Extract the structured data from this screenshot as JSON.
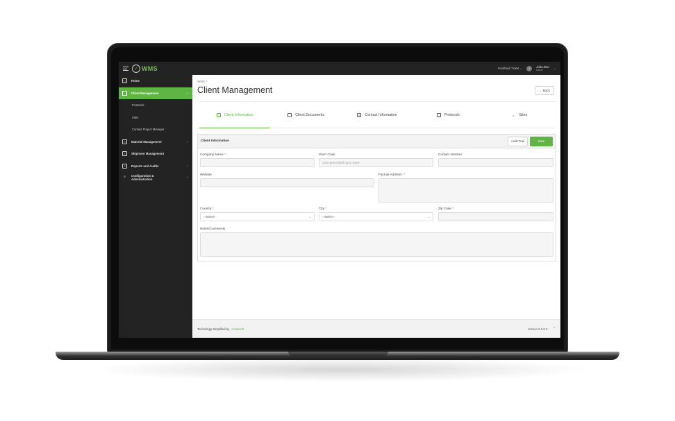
{
  "topbar": {
    "logo_text": "WMS",
    "logo_sub": "",
    "feedback": "Feedback Ticket",
    "user_name": "John.Doe",
    "user_role": "Admin",
    "avatar_initials": "J"
  },
  "sidebar": {
    "items": [
      {
        "label": "Home"
      },
      {
        "label": "Client Management"
      },
      {
        "label": "Protocols"
      },
      {
        "label": "Sites"
      },
      {
        "label": "Contact Project Manager"
      },
      {
        "label": "Material Management"
      },
      {
        "label": "Shipment Management"
      },
      {
        "label": "Reports and Audits"
      },
      {
        "label": "Configuration &"
      },
      {
        "label": "Administration"
      }
    ]
  },
  "main": {
    "breadcrumb": "WMS  \\",
    "title": "Client Management",
    "back_label": "← Back",
    "tabs": [
      {
        "label": "Client Information"
      },
      {
        "label": "Client Documents"
      },
      {
        "label": "Contact Information"
      },
      {
        "label": "Protocols"
      },
      {
        "label": "Sites"
      }
    ],
    "panel": {
      "title": "Client Information",
      "audit_label": "Audit Trail",
      "save_label": "Save",
      "fields": {
        "company_name": {
          "label": "Company Name",
          "value": ""
        },
        "short_code": {
          "label": "Short Code",
          "placeholder": "Auto-generated upon Save"
        },
        "contact_number": {
          "label": "Contact Number",
          "value": ""
        },
        "website": {
          "label": "Website",
          "value": ""
        },
        "factual_address": {
          "label": "Factual Address:",
          "value": ""
        },
        "country": {
          "label": "Country",
          "value": "--Select--"
        },
        "city": {
          "label": "City",
          "value": "--Select--"
        },
        "zip_code": {
          "label": "Zip Code",
          "value": ""
        },
        "notes": {
          "label": "Notes/Comments",
          "value": ""
        }
      },
      "required_marker": "*"
    }
  },
  "footer": {
    "left": "Technology Simplified by",
    "brand": "Colabsoft",
    "version": "Version 5.0.0.0",
    "caret": "^"
  },
  "colors": {
    "accent": "#5fb544",
    "sidebar_bg": "#232323",
    "required": "#e04848"
  },
  "icons": [
    "hamburger-icon",
    "wms-logo",
    "chevron-down-icon",
    "home-icon",
    "clipboard-icon",
    "document-icon",
    "user-settings-icon",
    "send-icon",
    "login-icon",
    "chevron-up-icon"
  ]
}
